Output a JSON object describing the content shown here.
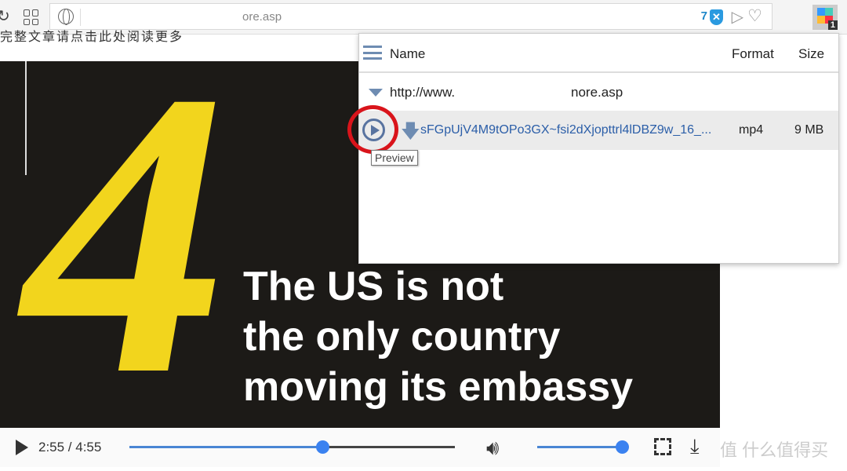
{
  "browser": {
    "url_visible": "ore.asp",
    "shield_count": "7",
    "shield_label": "✕",
    "extension_badge": "1"
  },
  "page": {
    "text": "完整文章请点击此处阅读更多"
  },
  "video": {
    "big_number": "4",
    "caption": [
      "The US is not",
      "the only country",
      "moving its embassy"
    ],
    "time": "2:55 / 4:55",
    "progress": 0.593,
    "volume": 1.0
  },
  "popup": {
    "headers": {
      "name": "Name",
      "format": "Format",
      "size": "Size"
    },
    "group_url_start": "http://www.",
    "group_url_end": "nore.asp",
    "file": {
      "name": "sFGpUjV4M9tOPo3GX~fsi2dXjopttrl4lDBZ9w_16_...",
      "format": "mp4",
      "size": "9 MB"
    },
    "tooltip": "Preview"
  },
  "watermark": "值 什么值得买",
  "colors": {
    "accent": "#3b82f0",
    "highlight_circle": "#d9141b",
    "link": "#2b5ea8"
  }
}
